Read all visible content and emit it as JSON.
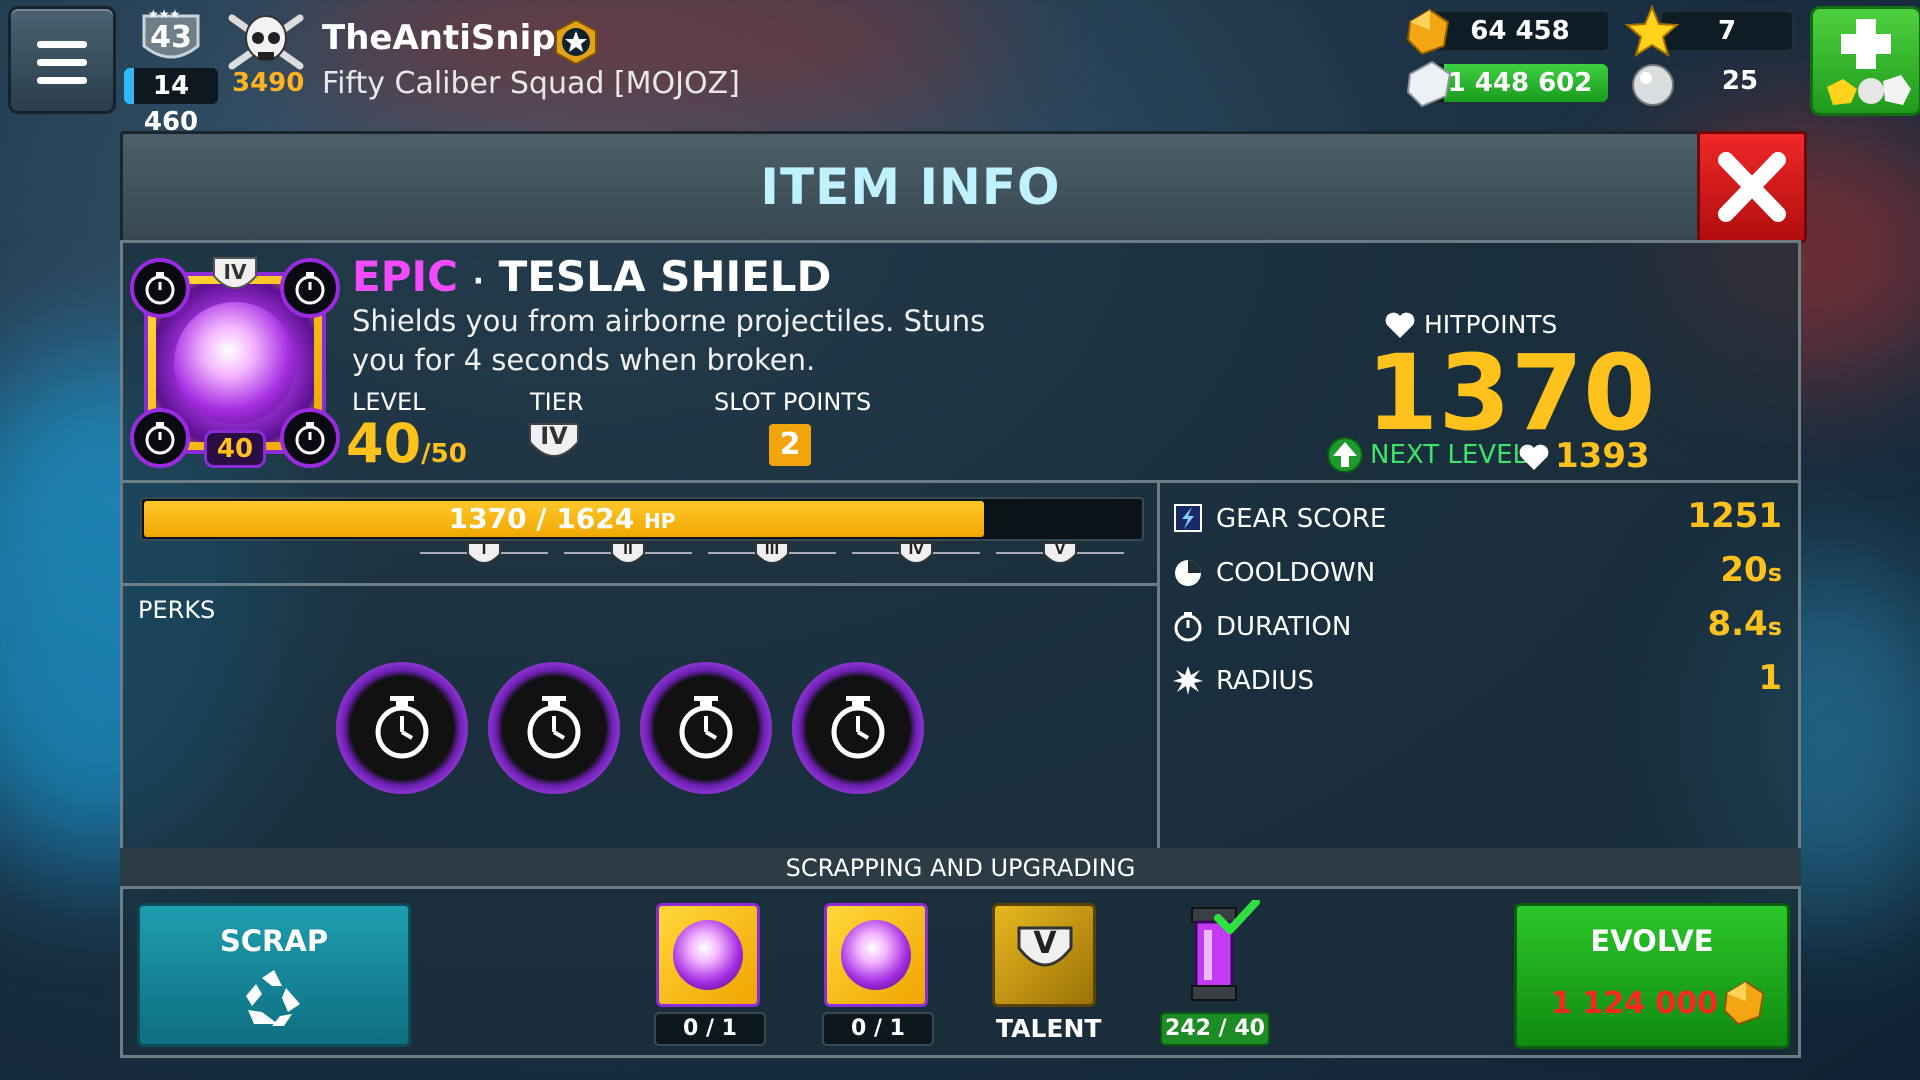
{
  "hud": {
    "player_level": "43",
    "xp": "14 460",
    "trophies": "3490",
    "player_name": "TheAntiSnipe",
    "clan": "Fifty Caliber Squad [MOJOZ]",
    "gold": "64 458",
    "stars": "7",
    "silver": "1 448 602",
    "orbs": "25"
  },
  "panel": {
    "title": "ITEM INFO"
  },
  "item": {
    "rarity": "EPIC",
    "separator": "·",
    "name": "TESLA SHIELD",
    "description": "Shields you from airborne projectiles. Stuns you for 4 seconds when broken.",
    "badge_tier": "IV",
    "badge_level": "40",
    "level_label": "LEVEL",
    "level_value": "40",
    "level_max": "/50",
    "tier_label": "TIER",
    "tier_value": "IV",
    "slot_points_label": "SLOT POINTS",
    "slot_points_value": "2"
  },
  "hitpoints": {
    "label": "HITPOINTS",
    "value": "1370",
    "next_label": "NEXT LEVEL:",
    "next_value": "1393"
  },
  "hp_bar": {
    "text": "1370 / 1624",
    "unit": "HP",
    "current": 1370,
    "max": 1624,
    "tiers": [
      "I",
      "II",
      "III",
      "IV",
      "V"
    ]
  },
  "perks": {
    "label": "PERKS",
    "items": [
      "stopwatch-icon",
      "stopwatch-icon",
      "stopwatch-icon",
      "stopwatch-icon"
    ]
  },
  "stats": [
    {
      "name": "GEAR SCORE",
      "value": "1251",
      "unit": "",
      "icon": "gear-score-icon"
    },
    {
      "name": "COOLDOWN",
      "value": "20",
      "unit": "s",
      "icon": "cooldown-icon"
    },
    {
      "name": "DURATION",
      "value": "8.4",
      "unit": "s",
      "icon": "stopwatch-icon"
    },
    {
      "name": "RADIUS",
      "value": "1",
      "unit": "",
      "icon": "radius-icon"
    }
  ],
  "scrapping": {
    "header": "SCRAPPING AND UPGRADING",
    "scrap_label": "SCRAP",
    "req1_count": "0 / 1",
    "req2_count": "0 / 1",
    "talent_label": "TALENT",
    "talent_tier": "V",
    "canister_count": "242 / 40",
    "evolve_label": "EVOLVE",
    "evolve_cost": "1 124 000"
  },
  "colors": {
    "accent_gold": "#ffc21c",
    "epic": "#f04bff",
    "title": "#bff1ff",
    "next_level": "#3ce46a",
    "evolve": "#1fa81e",
    "scrap": "#168596",
    "close": "#d81a1a"
  }
}
